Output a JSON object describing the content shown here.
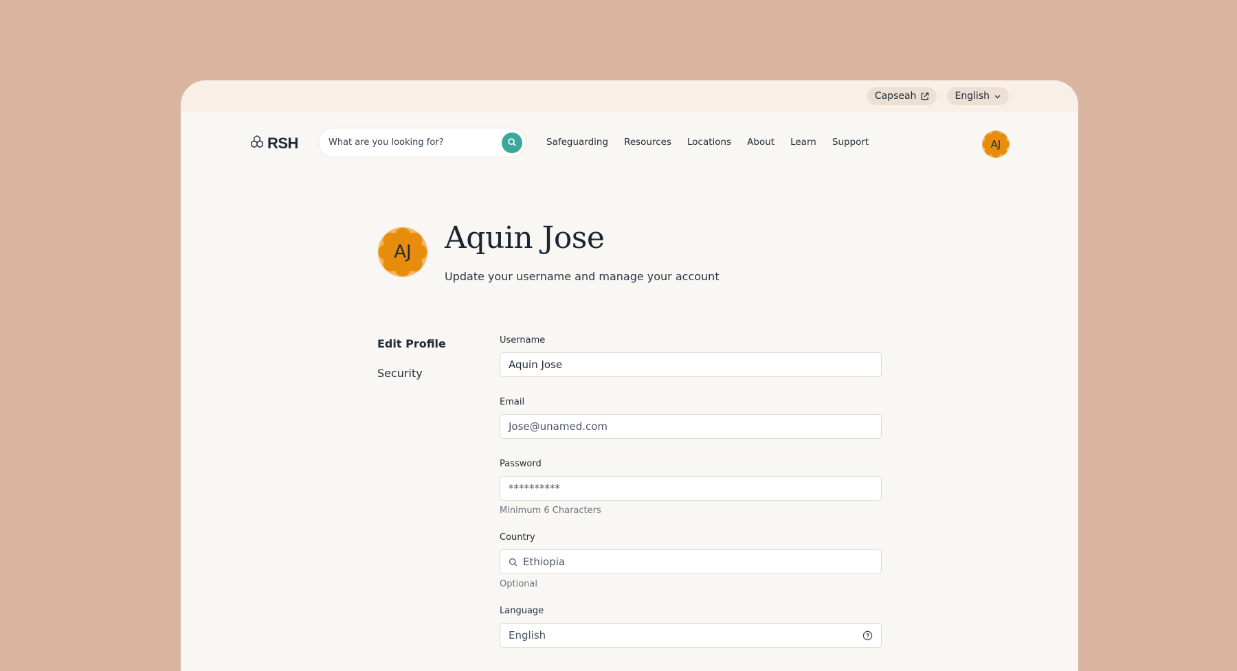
{
  "topbar": {
    "external_link_label": "Capseah",
    "language_label": "English"
  },
  "nav": {
    "logo_text": "RSH",
    "search_placeholder": "What are you looking for?",
    "links": [
      "Safeguarding",
      "Resources",
      "Locations",
      "About",
      "Learn",
      "Support"
    ],
    "avatar_initials": "AJ"
  },
  "profile": {
    "initials": "AJ",
    "name": "Aquin Jose",
    "subtitle": "Update your username and manage your account"
  },
  "side_menu": {
    "items": [
      "Edit Profile",
      "Security"
    ],
    "active_index": 0
  },
  "form": {
    "username": {
      "label": "Username",
      "value": "Aquin Jose"
    },
    "email": {
      "label": "Email",
      "value": "Jose@unamed.com"
    },
    "password": {
      "label": "Password",
      "value": "**********",
      "hint": "Minimum 6 Characters"
    },
    "country": {
      "label": "Country",
      "value": "Ethiopia",
      "hint": "Optional"
    },
    "language": {
      "label": "Language",
      "value": "English"
    }
  },
  "colors": {
    "background": "#d9b4a0",
    "page": "#f9f7f4",
    "topbar": "#f8efe6",
    "accent_teal": "#3aa89a",
    "avatar_orange": "#e88c0c"
  },
  "icons": {
    "external_link": "external-link-icon",
    "chevron": "chevron-down-icon",
    "search": "search-icon",
    "help": "help-circle-icon"
  }
}
